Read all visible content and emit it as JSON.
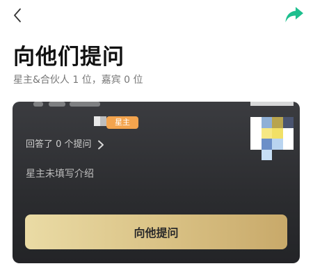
{
  "nav": {
    "back_icon": "chevron-left-icon",
    "share_icon": "share-arrow-icon",
    "share_color": "#1dbf8e"
  },
  "page": {
    "title": "向他们提问",
    "subtitle": "星主&合伙人 1 位，嘉宾 0 位"
  },
  "card": {
    "role_badge": "星主",
    "role_badge_color": "#f3a44e",
    "answered_text": "回答了 0 个提问",
    "intro_text": "星主未填写介绍",
    "ask_button_label": "向他提问",
    "background_color": "#2e2f32"
  }
}
